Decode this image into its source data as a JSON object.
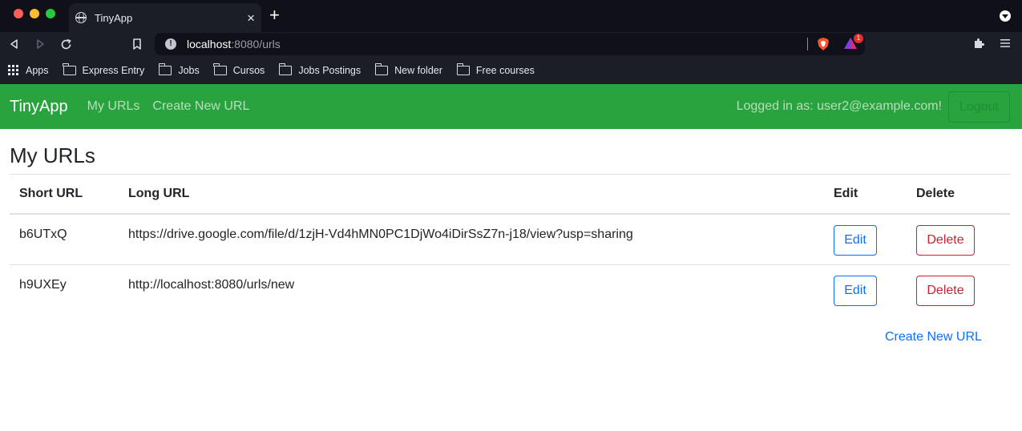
{
  "browser": {
    "tab_title": "TinyApp",
    "tab_close": "×",
    "new_tab": "+",
    "url_host": "localhost",
    "url_rest": ":8080/urls",
    "rewards_badge": "1",
    "bookmarks": [
      "Apps",
      "Express Entry",
      "Jobs",
      "Cursos",
      "Jobs Postings",
      "New folder",
      "Free courses"
    ]
  },
  "navbar": {
    "brand": "TinyApp",
    "links": [
      "My URLs",
      "Create New URL"
    ],
    "logged_in_text": "Logged in as: user2@example.com!",
    "logout_label": "Logout",
    "color": "#28a33e"
  },
  "page": {
    "title": "My URLs",
    "columns": [
      "Short URL",
      "Long URL",
      "Edit",
      "Delete"
    ],
    "rows": [
      {
        "short": "b6UTxQ",
        "long": "https://drive.google.com/file/d/1zjH-Vd4hMN0PC1DjWo4iDirSsZ7n-j18/view?usp=sharing",
        "edit": "Edit",
        "delete": "Delete"
      },
      {
        "short": "h9UXEy",
        "long": "http://localhost:8080/urls/new",
        "edit": "Edit",
        "delete": "Delete"
      }
    ],
    "create_link": "Create New URL"
  }
}
